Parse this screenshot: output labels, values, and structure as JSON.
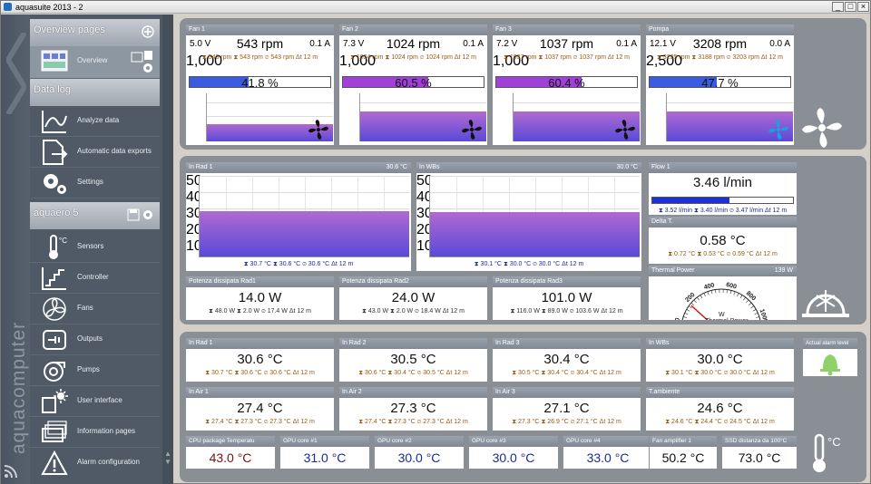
{
  "window": {
    "title": "aquasuite 2013 - 2",
    "min": "_",
    "max": "□",
    "close": "×"
  },
  "sidebar": {
    "brand": "aquacomputer",
    "sections": [
      {
        "label": "Overview pages"
      },
      {
        "label": "Data log"
      },
      {
        "label": "aquaero 5"
      }
    ],
    "items": {
      "overview": "Overview",
      "analyze": "Analyze data",
      "exports": "Automatic data exports",
      "settings": "Settings",
      "sensors": "Sensors",
      "controller": "Controller",
      "fans": "Fans",
      "outputs": "Outputs",
      "pumps": "Pumps",
      "ui": "User interface",
      "info": "Information pages",
      "alarm": "Alarm configuration"
    }
  },
  "fans": [
    {
      "name": "Fan 1",
      "volt": "5.0 V",
      "rpm": "543 rpm",
      "amp": "0.1 A",
      "s1": "⧗ 543 rpm",
      "s2": "⧗ 543 rpm",
      "s3": "⌀ 543 rpm",
      "s4": "Δt 12 m",
      "pct": "41.8 %",
      "pct_value": 41.8,
      "ytick": "1,000",
      "area": 0.35,
      "color": "#3a5be0"
    },
    {
      "name": "Fan 2",
      "volt": "7.3 V",
      "rpm": "1024 rpm",
      "amp": "0.1 A",
      "s1": "⧗ 1024 rpm",
      "s2": "⧗ 1024 rpm",
      "s3": "⌀ 1024 rpm",
      "s4": "Δt 12 m",
      "pct": "60.5 %",
      "pct_value": 60.5,
      "ytick": "1,000",
      "area": 0.62,
      "color": "#a040d8"
    },
    {
      "name": "Fan 3",
      "volt": "7.2 V",
      "rpm": "1037 rpm",
      "amp": "0.1 A",
      "s1": "⧗ 1037 rpm",
      "s2": "⧗ 1037 rpm",
      "s3": "⌀ 1037 rpm",
      "s4": "Δt 12 m",
      "pct": "60.4 %",
      "pct_value": 60.4,
      "ytick": "1,000",
      "area": 0.62,
      "color": "#a040d8"
    },
    {
      "name": "Pompa",
      "volt": "12.1 V",
      "rpm": "3208 rpm",
      "amp": "0.0 A",
      "s1": "⧗ 3225 rpm",
      "s2": "⧗ 3188 rpm",
      "s3": "⌀ 3203 rpm",
      "s4": "Δt 12 m",
      "pct": "47.7 %",
      "pct_value": 47.7,
      "ytick": "2,500",
      "area": 0.62,
      "color": "#3a5be0"
    }
  ],
  "rad_graphs": [
    {
      "name": "In Rad 1",
      "cur": "30.6 °C",
      "s1": "⧗ 30.7 °C",
      "s2": "⧗ 30.6 °C",
      "s3": "⌀ 30.6 °C",
      "s4": "Δt 12 m",
      "ticks": [
        "50",
        "40",
        "30",
        "20",
        "10"
      ],
      "level": 30.6
    },
    {
      "name": "In WBs",
      "cur": "30.0 °C",
      "s1": "⧗ 30.1 °C",
      "s2": "⧗ 30.0 °C",
      "s3": "⌀ 30.0 °C",
      "s4": "Δt 12 m",
      "ticks": [
        "50",
        "40",
        "30",
        "20",
        "10"
      ],
      "level": 30.0
    }
  ],
  "flow": {
    "name": "Flow 1",
    "value": "3.46 l/min",
    "bar": 0.55,
    "s1": "⧗ 3.52 l/min",
    "s2": "⧗ 3.40 l/min",
    "s3": "⌀ 3.47 l/min",
    "s4": "Δt 12 m"
  },
  "delta": {
    "name": "Delta T.",
    "value": "0.58 °C",
    "s1": "⧗ 0.72 °C",
    "s2": "⧗ 0.53 °C",
    "s3": "⌀ 0.59 °C",
    "s4": "Δt 12 m"
  },
  "thermal_power": {
    "name": "Thermal Power",
    "cur": "139 W",
    "unit": "W",
    "label": "Thermal Power",
    "ticks": [
      "0",
      "200",
      "400",
      "600",
      "800",
      "1000"
    ],
    "value": 139
  },
  "power": [
    {
      "name": "Potenza dissipata Rad1",
      "value": "14.0 W",
      "s1": "⧗ 48.0 W",
      "s2": "⧗ 2.0 W",
      "s3": "⌀ 17.4 W",
      "s4": "Δt 12 m"
    },
    {
      "name": "Potenza dissipata Rad2",
      "value": "24.0 W",
      "s1": "⧗ 43.0 W",
      "s2": "⧗ 2.0 W",
      "s3": "⌀ 18.4 W",
      "s4": "Δt 12 m"
    },
    {
      "name": "Potenza dissipata Rad3",
      "value": "101.0 W",
      "s1": "⧗ 116.0 W",
      "s2": "⧗ 89.0 W",
      "s3": "⌀ 103.6 W",
      "s4": "Δt 12 m"
    }
  ],
  "temps_row1": [
    {
      "name": "In Rad 1",
      "value": "30.6 °C",
      "s1": "⧗ 30.7 °C",
      "s2": "⧗ 30.6 °C",
      "s3": "⌀ 30.6 °C",
      "s4": "Δt 12 m"
    },
    {
      "name": "In Rad 2",
      "value": "30.5 °C",
      "s1": "⧗ 30.6 °C",
      "s2": "⧗ 30.4 °C",
      "s3": "⌀ 30.5 °C",
      "s4": "Δt 12 m"
    },
    {
      "name": "In Rad 3",
      "value": "30.4 °C",
      "s1": "⧗ 30.5 °C",
      "s2": "⧗ 30.4 °C",
      "s3": "⌀ 30.4 °C",
      "s4": "Δt 12 m"
    },
    {
      "name": "In WBs",
      "value": "30.0 °C",
      "s1": "⧗ 30.1 °C",
      "s2": "⧗ 30.0 °C",
      "s3": "⌀ 30.0 °C",
      "s4": "Δt 12 m"
    }
  ],
  "temps_row2": [
    {
      "name": "In Air 1",
      "value": "27.4 °C",
      "s1": "⧗ 27.4 °C",
      "s2": "⧗ 27.3 °C",
      "s3": "⌀ 27.3 °C",
      "s4": "Δt 12 m"
    },
    {
      "name": "In Air 2",
      "value": "27.3 °C",
      "s1": "⧗ 27.4 °C",
      "s2": "⧗ 27.3 °C",
      "s3": "⌀ 27.3 °C",
      "s4": "Δt 12 m"
    },
    {
      "name": "In Air 3",
      "value": "27.1 °C",
      "s1": "⧗ 27.3 °C",
      "s2": "⧗ 26.9 °C",
      "s3": "⌀ 27.1 °C",
      "s4": "Δt 12 m"
    },
    {
      "name": "T.ambiente",
      "value": "24.6 °C",
      "s1": "⧗ 24.6 °C",
      "s2": "⧗ 24.4 °C",
      "s3": "⌀ 24.5 °C",
      "s4": "Δt 12 m"
    }
  ],
  "temps_row3": [
    {
      "name": "CPU package Temperatu",
      "value": "43.0 °C",
      "tone": "red"
    },
    {
      "name": "GPU core #1",
      "value": "31.0 °C",
      "tone": "blue"
    },
    {
      "name": "GPU core #2",
      "value": "30.0 °C",
      "tone": "blue"
    },
    {
      "name": "GPU core #3",
      "value": "30.0 °C",
      "tone": "blue"
    },
    {
      "name": "GPU core #4",
      "value": "33.0 °C",
      "tone": "blue"
    },
    {
      "name": "Fan amplifier 1",
      "value": "50.2 °C",
      "tone": "dark"
    },
    {
      "name": "SSD distanza da 100°C",
      "value": "73.0 °C",
      "tone": "dark"
    }
  ],
  "alarm": {
    "label": "Actual alarm level"
  },
  "units": {
    "celsius": "°C"
  },
  "colors": {
    "accent": "#3a5be0",
    "purple": "#a040d8",
    "panel": "#8a8f95",
    "sidebar": "#4f5a66"
  }
}
